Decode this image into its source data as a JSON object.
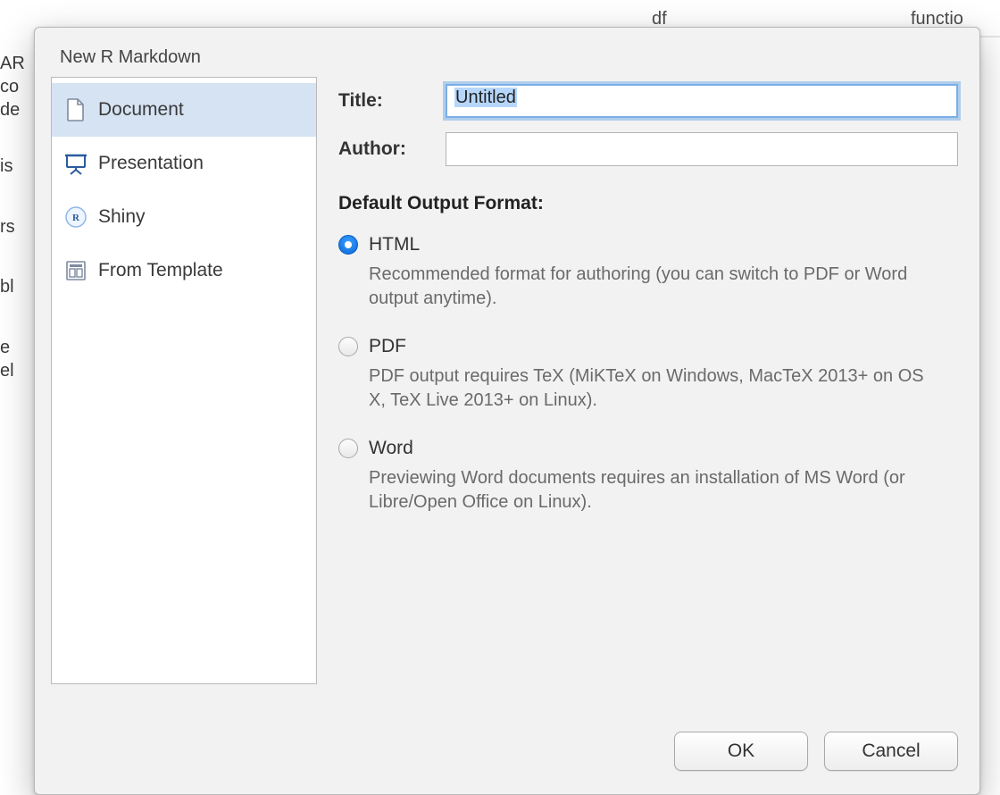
{
  "dialog": {
    "title": "New R Markdown"
  },
  "sidebar": {
    "items": [
      {
        "label": "Document"
      },
      {
        "label": "Presentation"
      },
      {
        "label": "Shiny"
      },
      {
        "label": "From Template"
      }
    ]
  },
  "fields": {
    "title_label": "Title:",
    "title_value": "Untitled",
    "author_label": "Author:",
    "author_value": ""
  },
  "format": {
    "heading": "Default Output Format:",
    "options": [
      {
        "label": "HTML",
        "selected": true,
        "description": "Recommended format for authoring (you can switch to PDF or Word output anytime)."
      },
      {
        "label": "PDF",
        "selected": false,
        "description": "PDF output requires TeX (MiKTeX on Windows, MacTeX 2013+ on OS X, TeX Live 2013+ on Linux)."
      },
      {
        "label": "Word",
        "selected": false,
        "description": "Previewing Word documents requires an installation of MS Word (or Libre/Open Office on Linux)."
      }
    ]
  },
  "buttons": {
    "ok": "OK",
    "cancel": "Cancel"
  },
  "background": {
    "var1": "df",
    "var2": "functio",
    "frag1": "AR",
    "frag2": "co",
    "frag3": "de",
    "frag4": "is",
    "frag5": "rs",
    "frag6": "bl",
    "frag7": "e",
    "frag8": "el"
  }
}
